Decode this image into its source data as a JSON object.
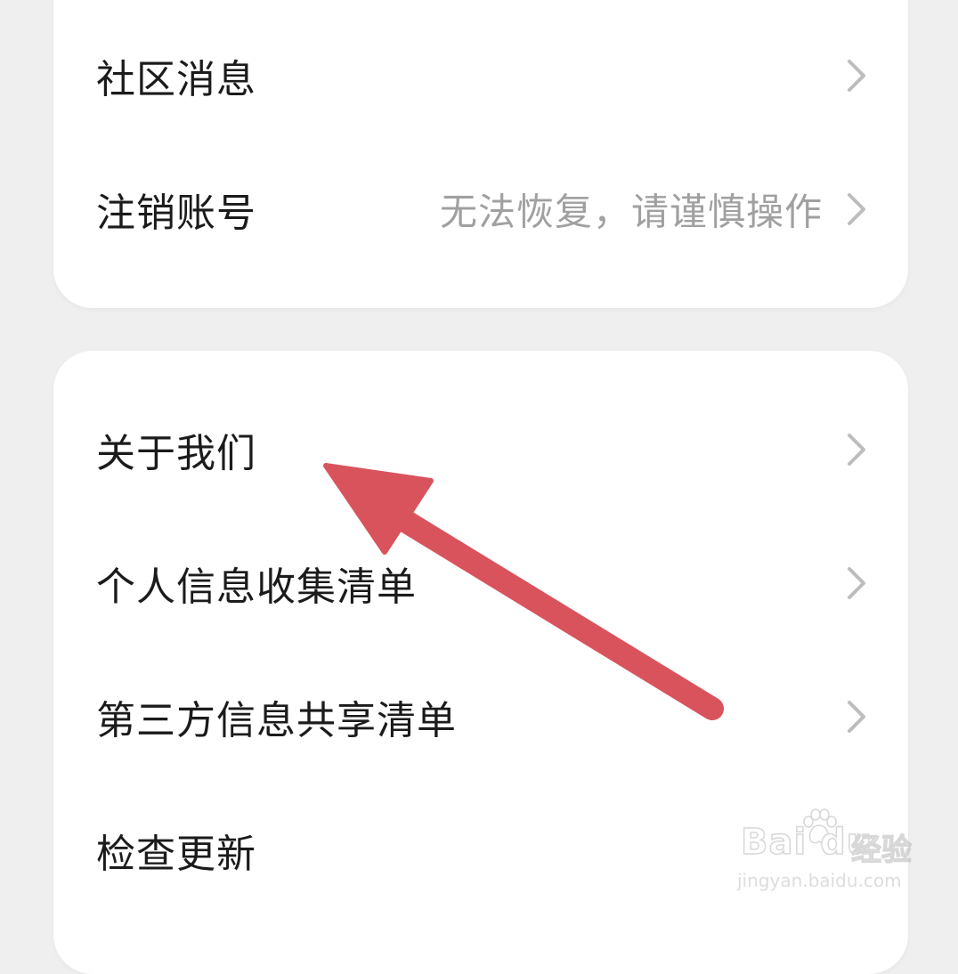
{
  "settings_top": {
    "items": [
      {
        "label": "社区消息",
        "value": ""
      },
      {
        "label": "注销账号",
        "value": "无法恢复，请谨慎操作"
      }
    ]
  },
  "settings_bottom": {
    "items": [
      {
        "label": "关于我们"
      },
      {
        "label": "个人信息收集清单"
      },
      {
        "label": "第三方信息共享清单"
      },
      {
        "label": "检查更新"
      }
    ]
  },
  "annotation": {
    "arrow_color": "#d9535d"
  },
  "watermark": {
    "brand": "Bai du",
    "sub": "经验",
    "url": "jingyan.baidu.com"
  },
  "icons": {
    "chevron": "chevron-right-icon",
    "annotation_arrow": "red-arrow-icon",
    "paw": "baidu-paw-icon"
  }
}
